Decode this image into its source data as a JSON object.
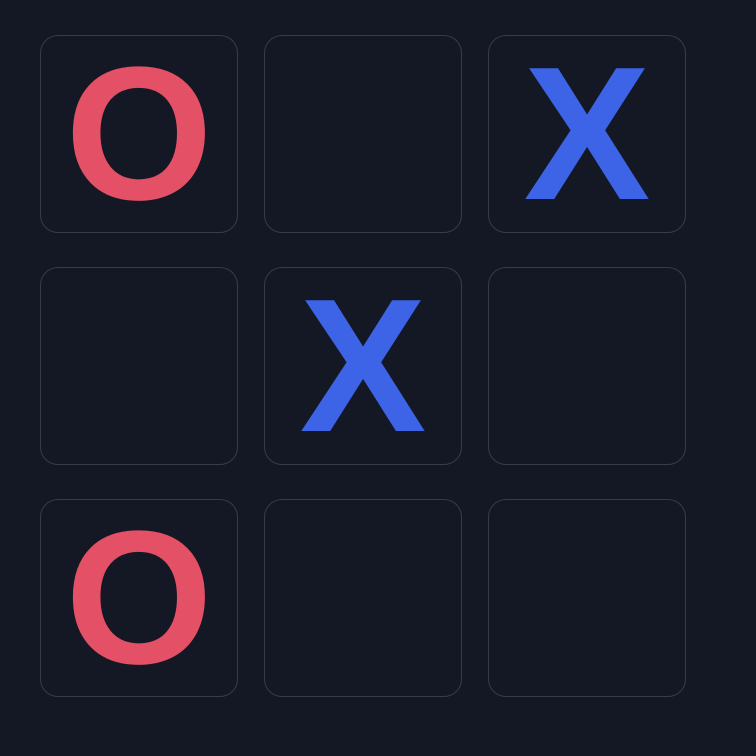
{
  "colors": {
    "background": "#131824",
    "cell_border": "#353c4a",
    "x_color": "#3d63e6",
    "o_color": "#e45066"
  },
  "board": {
    "cells": [
      {
        "value": "O"
      },
      {
        "value": ""
      },
      {
        "value": "X"
      },
      {
        "value": ""
      },
      {
        "value": "X"
      },
      {
        "value": ""
      },
      {
        "value": "O"
      },
      {
        "value": ""
      },
      {
        "value": ""
      }
    ]
  }
}
